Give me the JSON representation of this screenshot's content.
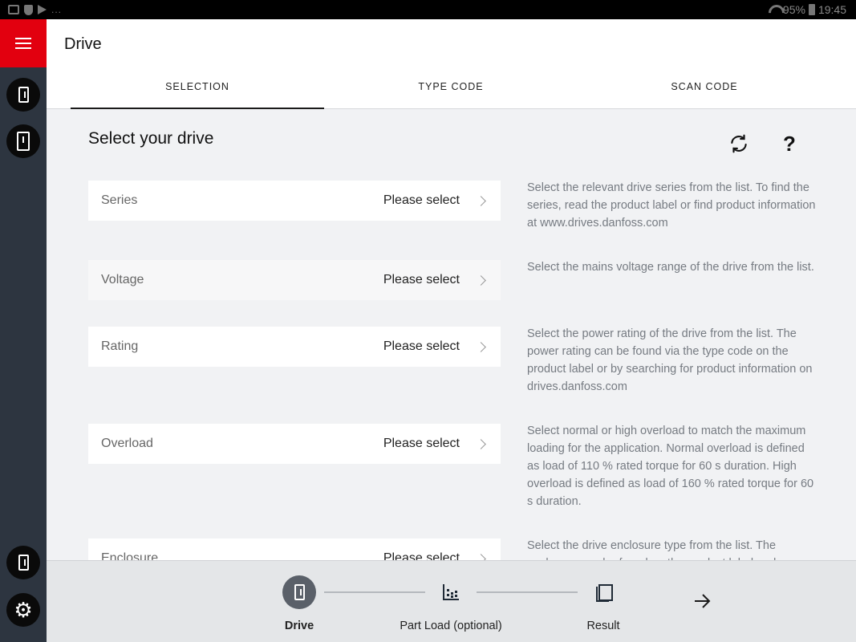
{
  "status_bar": {
    "battery": "95%",
    "time": "19:45",
    "more": "..."
  },
  "header": {
    "title": "Drive",
    "tabs": [
      {
        "label": "SELECTION",
        "active": true
      },
      {
        "label": "TYPE CODE",
        "active": false
      },
      {
        "label": "SCAN CODE",
        "active": false
      }
    ]
  },
  "main": {
    "section_title": "Select your drive",
    "actions": {
      "refresh_icon": "refresh-icon",
      "help_symbol": "?"
    },
    "fields": [
      {
        "label": "Series",
        "value": "Please select",
        "description": "Select the relevant drive series from the list. To find the series, read the product label or find product information at www.drives.danfoss.com"
      },
      {
        "label": "Voltage",
        "value": "Please select",
        "description": "Select the mains voltage range of the drive from the list."
      },
      {
        "label": "Rating",
        "value": "Please select",
        "description": "Select the power rating of the drive from the list. The power rating can be found via the type code on the product label or by searching for product information on drives.danfoss.com"
      },
      {
        "label": "Overload",
        "value": "Please select",
        "description": "Select normal or high overload to match the maximum loading for the application. Normal overload is defined as load of 110 % rated torque for 60 s duration. High overload is defined as load of 160 % rated torque for 60 s duration."
      },
      {
        "label": "Enclosure",
        "value": "Please select",
        "description": "Select the drive enclosure type from the list. The enclosure can be found on the product label and"
      }
    ]
  },
  "stepper": {
    "steps": [
      {
        "label": "Drive",
        "icon": "drive-icon",
        "active": true
      },
      {
        "label": "Part Load (optional)",
        "icon": "chart-icon",
        "active": false
      },
      {
        "label": "Result",
        "icon": "document-icon",
        "active": false
      }
    ],
    "next_icon": "arrow-right-icon"
  },
  "colors": {
    "brand_red": "#e2000f",
    "rail": "#2d3540",
    "background": "#f1f2f4"
  }
}
